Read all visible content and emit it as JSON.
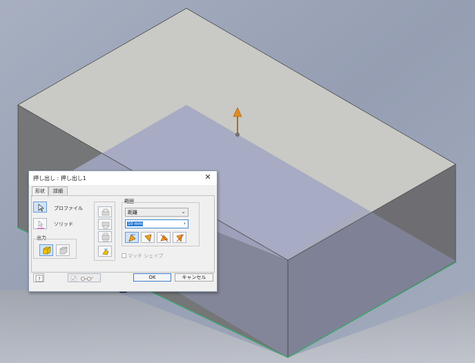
{
  "dialog": {
    "title": "押し出し : 押し出し1",
    "close_glyph": "✕",
    "tabs": [
      {
        "label": "形状",
        "active": true
      },
      {
        "label": "詳細",
        "active": false
      }
    ]
  },
  "shape_tab": {
    "profile_label": "プロファイル",
    "solid_label": "ソリッド",
    "output_label": "出力",
    "extents_label": "範囲",
    "extents_value": "距離",
    "distance_value": "10 mm",
    "match_shape_label": "マッチ シェイプ"
  },
  "footer": {
    "help_icon": "help-icon",
    "ok_label": "OK",
    "cancel_label": "キャンセル"
  },
  "colors": {
    "viewport_bg": "#9ea6b8",
    "box_top": "#c9c9c5",
    "sketch_plane": "#a3a8bf",
    "edge_highlight": "#3aa86a",
    "arrow_orange": "#d98a1e",
    "selection_blue": "#2a7bd6"
  }
}
